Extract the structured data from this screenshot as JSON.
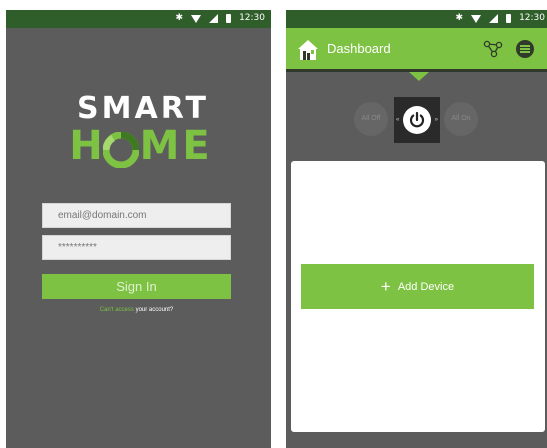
{
  "status_bar": {
    "time": "12:30",
    "icons": [
      "bluetooth-icon",
      "wifi-icon",
      "signal-icon",
      "battery-icon"
    ]
  },
  "login": {
    "logo_top": "SMART",
    "logo_bottom": "H  ME",
    "email_placeholder": "email@domain.com",
    "password_value": "**********",
    "sign_in_label": "Sign In",
    "forgot_link": "Can't access",
    "forgot_rest": " your account?"
  },
  "dashboard": {
    "title": "Dashboard",
    "all_off_label": "All Off",
    "all_on_label": "All On",
    "add_device_label": "Add Device"
  },
  "colors": {
    "accent_green": "#7dc242",
    "status_bar": "#2f5e2a",
    "background_gray": "#5c5c5c"
  }
}
